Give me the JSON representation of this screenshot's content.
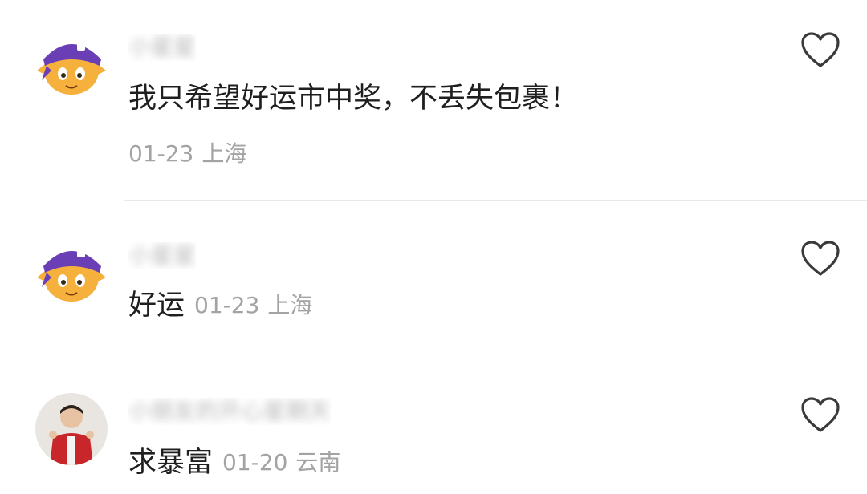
{
  "comments": [
    {
      "username": "小星星",
      "text": "我只希望好运市中奖，不丢失包裹！",
      "date": "01-23",
      "location": "上海",
      "avatar": "purple-bandana-cartoon-avatar"
    },
    {
      "username": "小星星",
      "text": "好运",
      "date": "01-23",
      "location": "上海",
      "avatar": "purple-bandana-cartoon-avatar"
    },
    {
      "username": "小朋友的开心星期天",
      "text": "求暴富",
      "date": "01-20",
      "location": "云南",
      "avatar": "child-photo-avatar"
    }
  ],
  "icons": {
    "like": "heart-outline-icon"
  },
  "colors": {
    "text": "#1f1f1f",
    "meta": "#a3a3a3",
    "divider": "#e8e8e8",
    "avatar_purple": "#6a3fb5",
    "avatar_skin": "#f5b13c"
  }
}
